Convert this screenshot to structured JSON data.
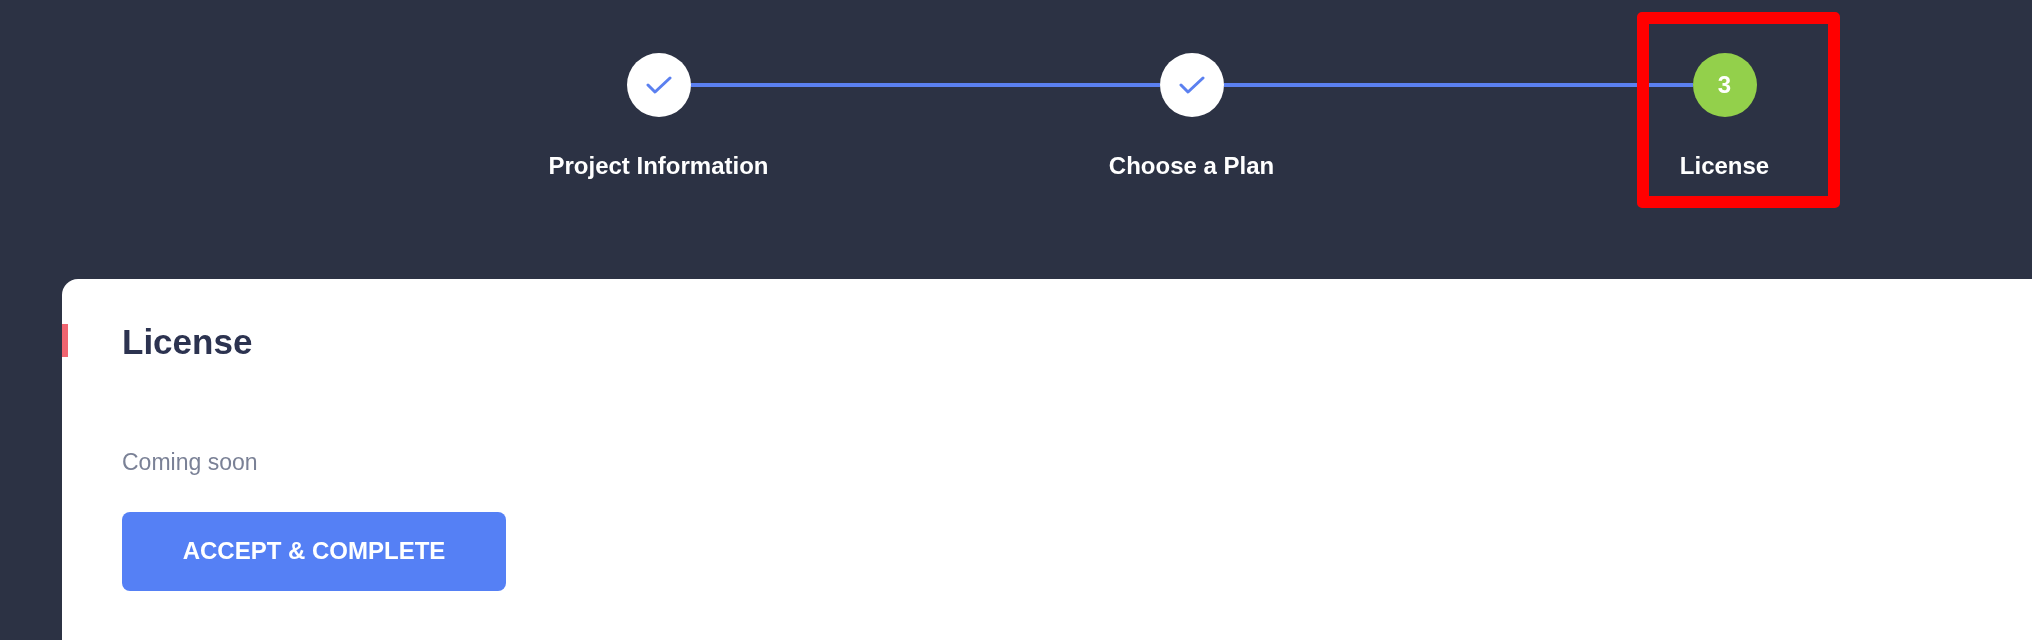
{
  "steps": [
    {
      "label": "Project Information",
      "completed": true,
      "highlighted": false
    },
    {
      "label": "Choose a Plan",
      "completed": true,
      "highlighted": false
    },
    {
      "label": "License",
      "completed": false,
      "number": "3",
      "highlighted": true
    }
  ],
  "panel": {
    "title": "License",
    "message": "Coming soon",
    "button": "ACCEPT & COMPLETE"
  }
}
